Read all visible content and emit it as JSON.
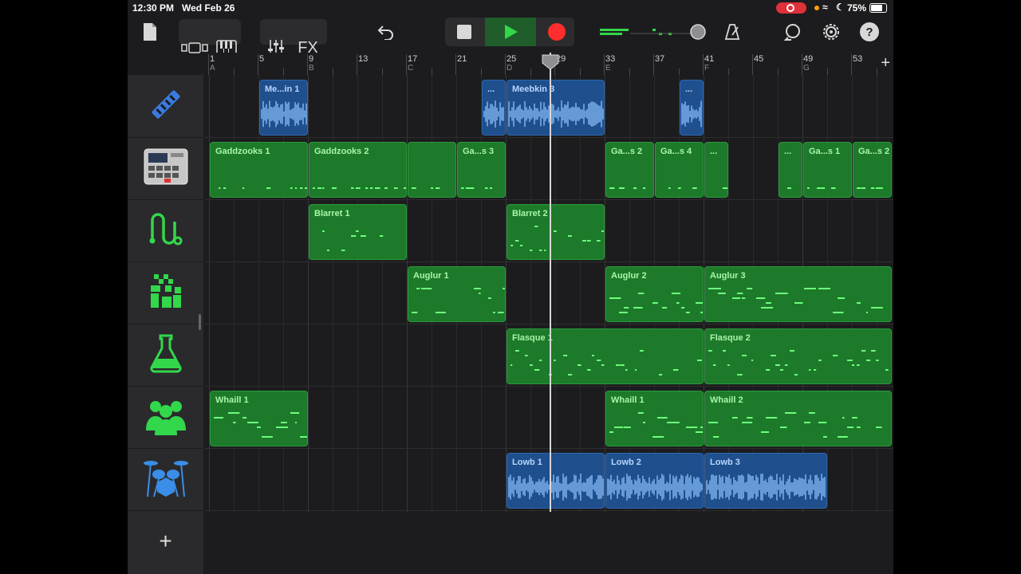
{
  "status": {
    "time": "12:30 PM",
    "date": "Wed Feb 26",
    "battery": "75%"
  },
  "toolbar": {
    "fx_label": "FX",
    "help_label": "?"
  },
  "ruler": {
    "bars": [
      {
        "num": "1",
        "sec": "A"
      },
      {
        "num": "5",
        "sec": ""
      },
      {
        "num": "9",
        "sec": "B"
      },
      {
        "num": "13",
        "sec": ""
      },
      {
        "num": "17",
        "sec": "C"
      },
      {
        "num": "21",
        "sec": ""
      },
      {
        "num": "25",
        "sec": "D"
      },
      {
        "num": "29",
        "sec": ""
      },
      {
        "num": "33",
        "sec": "E"
      },
      {
        "num": "37",
        "sec": ""
      },
      {
        "num": "41",
        "sec": "F"
      },
      {
        "num": "45",
        "sec": ""
      },
      {
        "num": "49",
        "sec": "G"
      },
      {
        "num": "53",
        "sec": ""
      }
    ],
    "add_label": "+"
  },
  "tracks": [
    {
      "icon": "sampler-icon",
      "color": "blue",
      "regions": [
        {
          "label": "Me...in 1",
          "start": 5,
          "end": 9
        },
        {
          "label": "...",
          "start": 23,
          "end": 25
        },
        {
          "label": "Meebkin 3",
          "start": 25,
          "end": 33
        },
        {
          "label": "...",
          "start": 39,
          "end": 41
        }
      ]
    },
    {
      "icon": "beat-sequencer-icon",
      "color": "green",
      "regions": [
        {
          "label": "Gaddzooks 1",
          "start": 1,
          "end": 9
        },
        {
          "label": "Gaddzooks 2",
          "start": 9,
          "end": 17
        },
        {
          "label": "",
          "start": 17,
          "end": 21
        },
        {
          "label": "Ga...s 3",
          "start": 21,
          "end": 25
        },
        {
          "label": "Ga...s 2",
          "start": 33,
          "end": 37
        },
        {
          "label": "Ga...s 4",
          "start": 37,
          "end": 41
        },
        {
          "label": "...",
          "start": 41,
          "end": 43
        },
        {
          "label": "...",
          "start": 47,
          "end": 49
        },
        {
          "label": "Ga...s 1",
          "start": 49,
          "end": 53
        },
        {
          "label": "Ga...s 2",
          "start": 53,
          "end": 57
        }
      ]
    },
    {
      "icon": "alchemy-synth-icon",
      "color": "green",
      "regions": [
        {
          "label": "Blarret 1",
          "start": 9,
          "end": 17
        },
        {
          "label": "Blarret 2",
          "start": 25,
          "end": 33
        }
      ]
    },
    {
      "icon": "pixel-keys-icon",
      "color": "green",
      "regions": [
        {
          "label": "Auglur 1",
          "start": 17,
          "end": 25
        },
        {
          "label": "Auglur 2",
          "start": 33,
          "end": 41
        },
        {
          "label": "Auglur 3",
          "start": 41,
          "end": 57
        }
      ]
    },
    {
      "icon": "flask-icon",
      "color": "green",
      "regions": [
        {
          "label": "Flasque 1",
          "start": 25,
          "end": 41
        },
        {
          "label": "Flasque 2",
          "start": 41,
          "end": 57
        }
      ]
    },
    {
      "icon": "choir-icon",
      "color": "green",
      "regions": [
        {
          "label": "Whaill 1",
          "start": 1,
          "end": 9
        },
        {
          "label": "Whaill 1",
          "start": 33,
          "end": 41
        },
        {
          "label": "Whaill 2",
          "start": 41,
          "end": 57
        }
      ]
    },
    {
      "icon": "drum-kit-icon",
      "color": "blue",
      "regions": [
        {
          "label": "Lowb 1",
          "start": 25,
          "end": 33
        },
        {
          "label": "Lowb 2",
          "start": 33,
          "end": 41
        },
        {
          "label": "Lowb 3",
          "start": 41,
          "end": 51
        }
      ]
    }
  ],
  "playhead_bar": 29,
  "add_track_label": "+"
}
